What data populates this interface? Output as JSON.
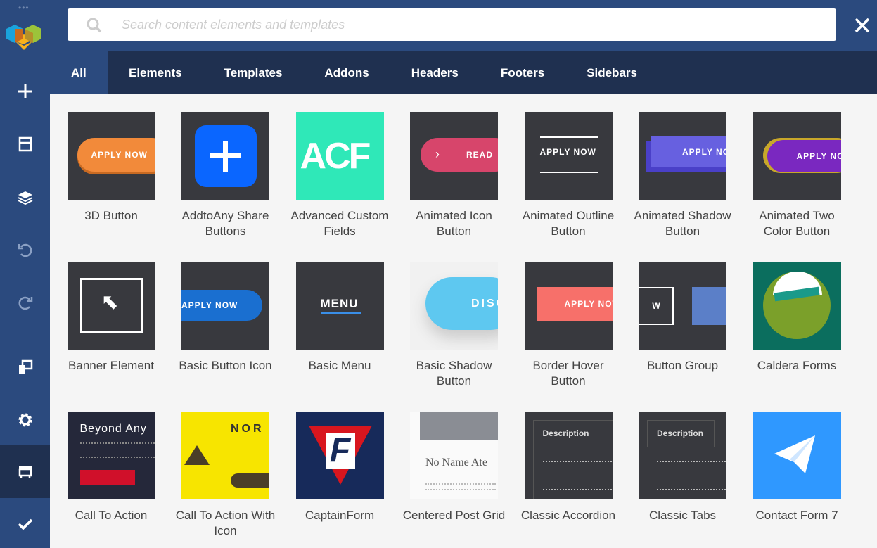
{
  "sidebar": {
    "items": [
      {
        "icon": "plus-icon"
      },
      {
        "icon": "layout-icon"
      },
      {
        "icon": "layers-icon"
      },
      {
        "icon": "undo-icon"
      },
      {
        "icon": "redo-icon"
      },
      {
        "icon": "responsive-icon"
      },
      {
        "icon": "settings-icon"
      },
      {
        "icon": "store-icon",
        "active": true
      },
      {
        "icon": "check-icon"
      }
    ]
  },
  "search": {
    "placeholder": "Search content elements and templates",
    "value": ""
  },
  "tabs": [
    "All",
    "Elements",
    "Templates",
    "Addons",
    "Headers",
    "Footers",
    "Sidebars"
  ],
  "active_tab": "All",
  "elements": [
    {
      "label": "3D Button",
      "thumb_text": "APPLY NOW"
    },
    {
      "label": "AddtoAny Share Buttons",
      "thumb_text": ""
    },
    {
      "label": "Advanced Custom Fields",
      "thumb_text": "ACF"
    },
    {
      "label": "Animated Icon Button",
      "thumb_text": "READ"
    },
    {
      "label": "Animated Outline Button",
      "thumb_text": "APPLY NOW"
    },
    {
      "label": "Animated Shadow Button",
      "thumb_text": "APPLY NOW"
    },
    {
      "label": "Animated Two Color Button",
      "thumb_text": "APPLY NOW"
    },
    {
      "label": "Banner Element",
      "thumb_text": ""
    },
    {
      "label": "Basic Button Icon",
      "thumb_text": "APPLY NOW"
    },
    {
      "label": "Basic Menu",
      "thumb_text": "MENU"
    },
    {
      "label": "Basic Shadow Button",
      "thumb_text": "DISCOVER"
    },
    {
      "label": "Border Hover Button",
      "thumb_text": "APPLY NOW"
    },
    {
      "label": "Button Group",
      "thumb_text": "W"
    },
    {
      "label": "Caldera Forms",
      "thumb_text": ""
    },
    {
      "label": "Call To Action",
      "thumb_text": "Beyond Any"
    },
    {
      "label": "Call To Action With Icon",
      "thumb_text": "NOR"
    },
    {
      "label": "CaptainForm",
      "thumb_text": "F"
    },
    {
      "label": "Centered Post Grid",
      "thumb_text": "No Name Ate"
    },
    {
      "label": "Classic Accordion",
      "thumb_text": "Description"
    },
    {
      "label": "Classic Tabs",
      "thumb_text": "Description"
    },
    {
      "label": "Contact Form 7",
      "thumb_text": ""
    }
  ]
}
